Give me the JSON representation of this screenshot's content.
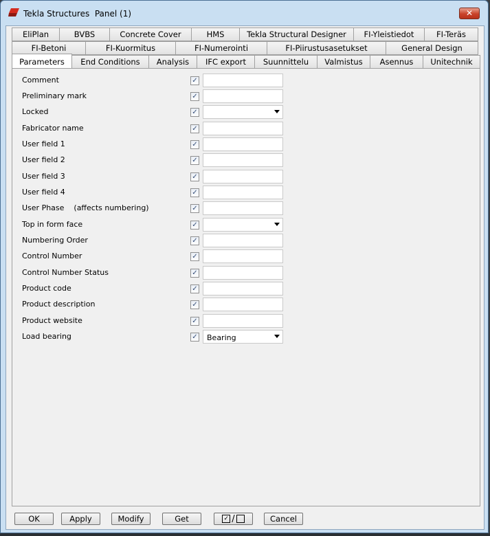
{
  "window": {
    "title": "Tekla Structures  Panel (1)",
    "close_symbol": "✕",
    "icon": "tekla-app-icon"
  },
  "tabs": {
    "row1": [
      "EliPlan",
      "BVBS",
      "Concrete Cover",
      "HMS",
      "Tekla Structural Designer",
      "FI-Yleistiedot",
      "FI-Teräs"
    ],
    "row2": [
      "FI-Betoni",
      "FI-Kuormitus",
      "FI-Numerointi",
      "FI-Piirustusasetukset",
      "General Design"
    ],
    "row3": [
      "Parameters",
      "End Conditions",
      "Analysis",
      "IFC export",
      "Suunnittelu",
      "Valmistus",
      "Asennus",
      "Unitechnik"
    ],
    "active": "Parameters"
  },
  "fields": [
    {
      "label": "Comment",
      "type": "text",
      "value": "",
      "checked": true
    },
    {
      "label": "Preliminary mark",
      "type": "text",
      "value": "",
      "checked": true
    },
    {
      "label": "Locked",
      "type": "select",
      "value": "",
      "checked": true
    },
    {
      "label": "Fabricator name",
      "type": "text",
      "value": "",
      "checked": true
    },
    {
      "label": "User field 1",
      "type": "text",
      "value": "",
      "checked": true
    },
    {
      "label": "User field 2",
      "type": "text",
      "value": "",
      "checked": true
    },
    {
      "label": "User field 3",
      "type": "text",
      "value": "",
      "checked": true
    },
    {
      "label": "User field 4",
      "type": "text",
      "value": "",
      "checked": true
    },
    {
      "label": "User Phase    (affects numbering)",
      "type": "text",
      "value": "",
      "checked": true
    },
    {
      "label": "Top in form face",
      "type": "select",
      "value": "",
      "checked": true
    },
    {
      "label": "Numbering Order",
      "type": "text",
      "value": "",
      "checked": true
    },
    {
      "label": "Control Number",
      "type": "text",
      "value": "",
      "checked": true
    },
    {
      "label": "Control Number Status",
      "type": "text",
      "value": "",
      "checked": true
    },
    {
      "label": "Product code",
      "type": "text",
      "value": "",
      "checked": true
    },
    {
      "label": "Product description",
      "type": "text",
      "value": "",
      "checked": true
    },
    {
      "label": "Product website",
      "type": "text",
      "value": "",
      "checked": true
    },
    {
      "label": "Load bearing",
      "type": "select",
      "value": "Bearing",
      "checked": true
    }
  ],
  "buttons": {
    "ok": "OK",
    "apply": "Apply",
    "modify": "Modify",
    "get": "Get",
    "toggle_slash": "/",
    "cancel": "Cancel"
  },
  "colors": {
    "frame": "#c9dff2",
    "client": "#f0f0f0",
    "close_red": "#c9432a",
    "checkmark": "#37507a"
  }
}
